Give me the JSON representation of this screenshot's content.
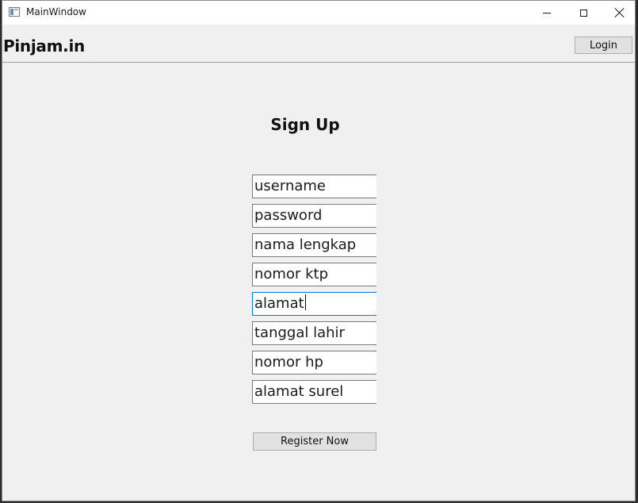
{
  "window": {
    "title": "MainWindow"
  },
  "header": {
    "brand": "Pinjam.in",
    "login_label": "Login"
  },
  "form": {
    "title": "Sign Up",
    "fields": [
      {
        "value": "username"
      },
      {
        "value": "password"
      },
      {
        "value": "nama lengkap"
      },
      {
        "value": "nomor ktp"
      },
      {
        "value": "alamat",
        "focused": true
      },
      {
        "value": "tanggal lahir"
      },
      {
        "value": "nomor hp"
      },
      {
        "value": "alamat surel"
      }
    ],
    "register_label": "Register Now"
  },
  "colors": {
    "window_bg": "#f0f0f0",
    "focus_border": "#0078d7",
    "button_bg": "#e1e1e1"
  },
  "icons": [
    "app-icon",
    "minimize-icon",
    "maximize-icon",
    "close-icon",
    "text-caret"
  ]
}
